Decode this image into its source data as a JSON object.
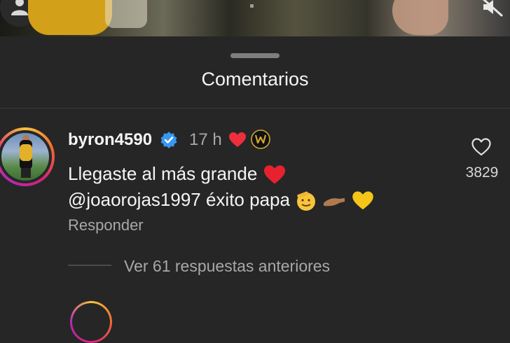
{
  "sheet": {
    "title": "Comentarios"
  },
  "comment": {
    "username": "byron4590",
    "time": "17 h",
    "text_line1": "Llegaste al más grande",
    "mention": "@joaorojas1997",
    "text_line2_rest": " éxito papa",
    "reply_label": "Responder",
    "like_count": "3829",
    "view_replies": "Ver 61 respuestas anteriores"
  },
  "colors": {
    "background": "#262626",
    "verified": "#3897f0",
    "heart": "#ed2e3b",
    "secondary_text": "#a8a8a8"
  },
  "icons": {
    "verified": "verified-badge-icon",
    "author_like": "heart-icon",
    "like": "heart-outline-icon",
    "mute": "speaker-muted-icon"
  }
}
